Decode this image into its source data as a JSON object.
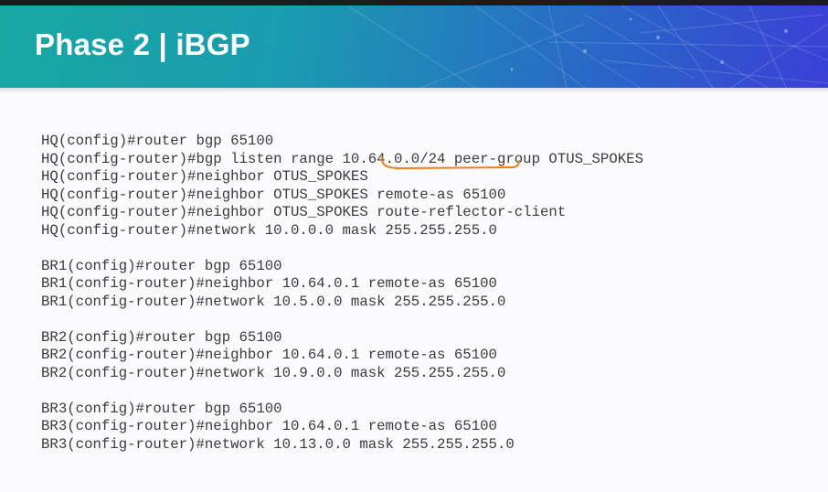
{
  "slide": {
    "title": "Phase 2 | iBGP"
  },
  "config_blocks": [
    {
      "lines": [
        "HQ(config)#router bgp 65100",
        "HQ(config-router)#bgp listen range 10.64.0.0/24 peer-group OTUS_SPOKES",
        "HQ(config-router)#neighbor OTUS_SPOKES",
        "HQ(config-router)#neighbor OTUS_SPOKES remote-as 65100",
        "HQ(config-router)#neighbor OTUS_SPOKES route-reflector-client",
        "HQ(config-router)#network 10.0.0.0 mask 255.255.255.0"
      ]
    },
    {
      "lines": [
        "BR1(config)#router bgp 65100",
        "BR1(config-router)#neighbor 10.64.0.1 remote-as 65100",
        "BR1(config-router)#network 10.5.0.0 mask 255.255.255.0"
      ]
    },
    {
      "lines": [
        "BR2(config)#router bgp 65100",
        "BR2(config-router)#neighbor 10.64.0.1 remote-as 65100",
        "BR2(config-router)#network 10.9.0.0 mask 255.255.255.0"
      ]
    },
    {
      "lines": [
        "BR3(config)#router bgp 65100",
        "BR3(config-router)#neighbor 10.64.0.1 remote-as 65100",
        "BR3(config-router)#network 10.13.0.0 mask 255.255.255.0"
      ]
    }
  ],
  "colors": {
    "header_start": "#17a8a2",
    "header_end": "#3b3fd6",
    "title_text": "#ffffff",
    "code_text": "#3b3b3b",
    "annotation": "#f07d1a"
  }
}
